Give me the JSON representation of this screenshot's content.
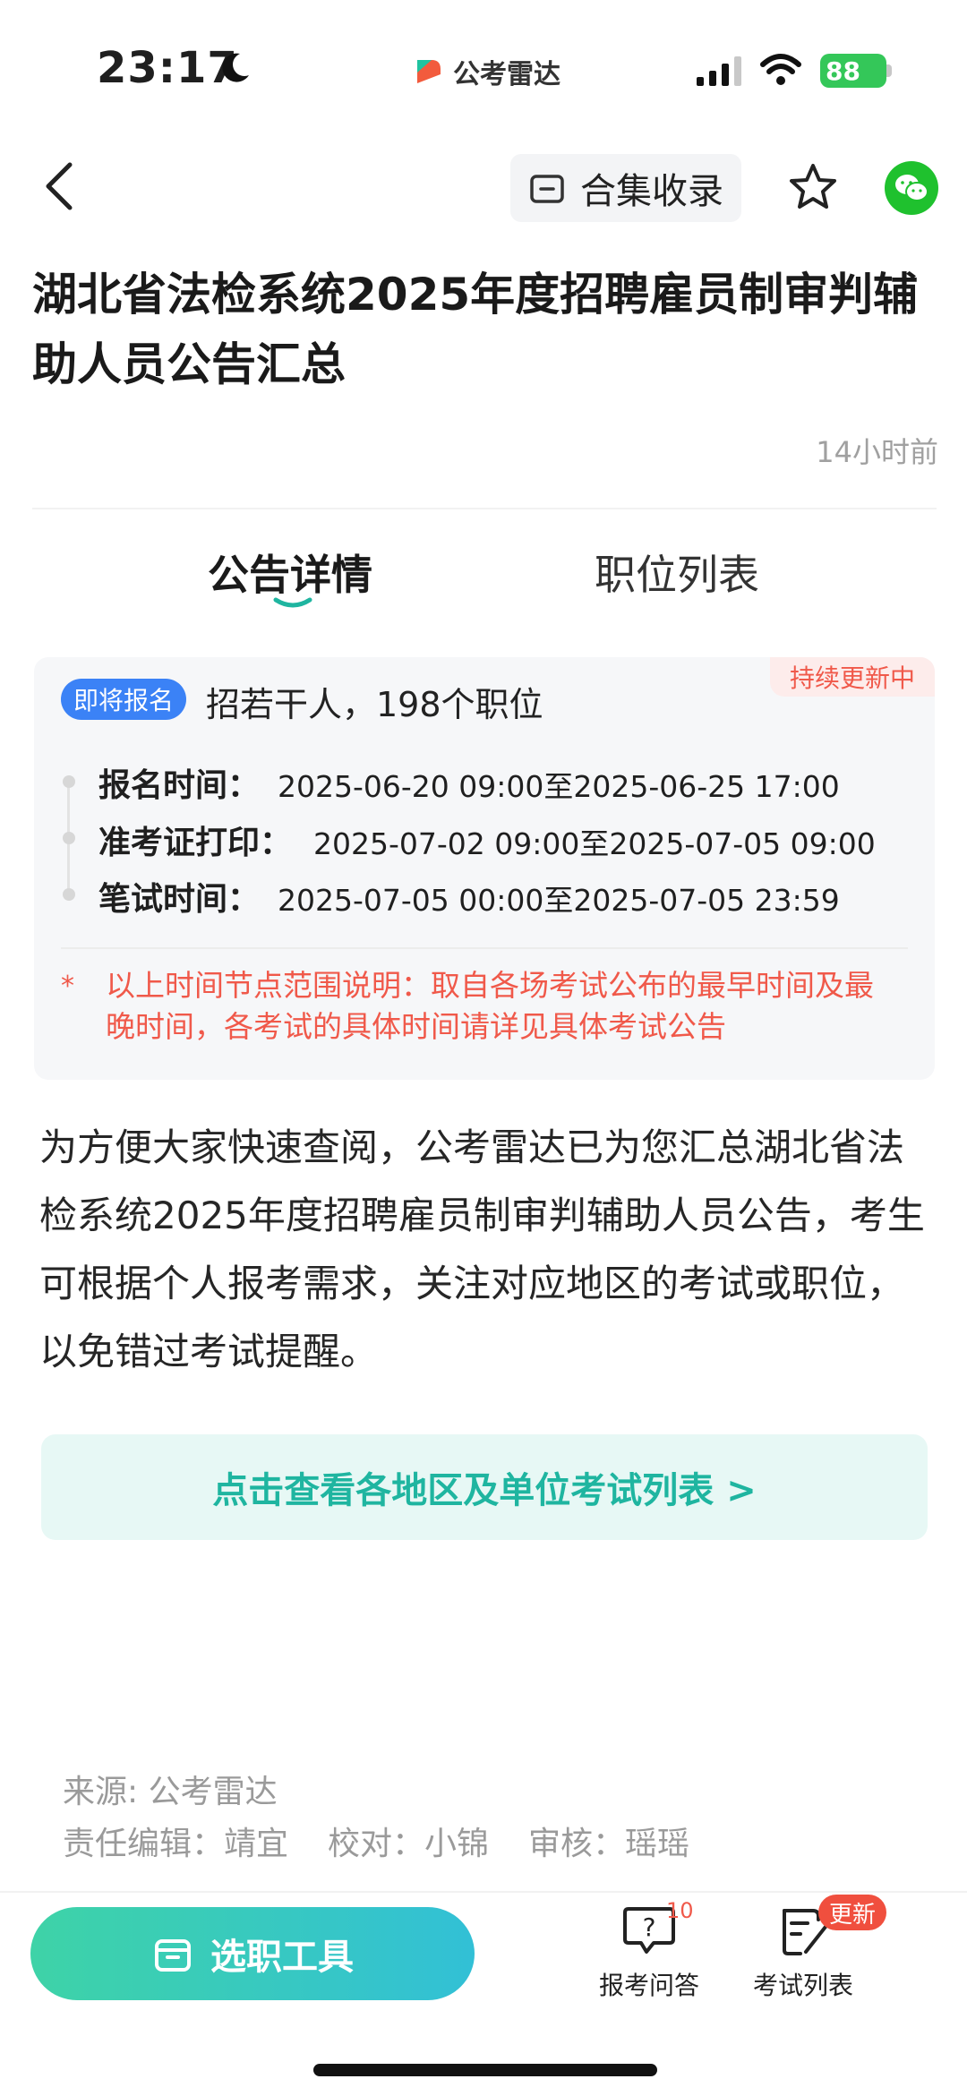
{
  "status_bar": {
    "time": "23:17",
    "app_name": "公考雷达",
    "battery": "88"
  },
  "nav": {
    "collect_label": "合集收录"
  },
  "article": {
    "title": "湖北省法检系统2025年度招聘雇员制审判辅助人员公告汇总",
    "time_ago": "14小时前"
  },
  "tabs": {
    "detail": "公告详情",
    "jobs": "职位列表"
  },
  "card": {
    "badge": "持续更新中",
    "status": "即将报名",
    "summary": "招若干人，198个职位",
    "timeline": [
      {
        "label": "报名时间：",
        "value": "2025-06-20 09:00至2025-06-25 17:00"
      },
      {
        "label": "准考证打印：",
        "value": "2025-07-02 09:00至2025-07-05 09:00"
      },
      {
        "label": "笔试时间：",
        "value": "2025-07-05 00:00至2025-07-05 23:59"
      }
    ],
    "note_mark": "*",
    "note": "以上时间节点范围说明：取自各场考试公布的最早时间及最晚时间，各考试的具体时间请详见具体考试公告"
  },
  "body": "为方便大家快速查阅，公考雷达已为您汇总湖北省法检系统2025年度招聘雇员制审判辅助人员公告，考生可根据个人报考需求，关注对应地区的考试或职位，以免错过考试提醒。",
  "cta_label": "点击查看各地区及单位考试列表 >",
  "footer": {
    "source": "来源: 公考雷达",
    "editor": "责任编辑：靖宜",
    "proof": "校对：小锦",
    "review": "审核：瑶瑶"
  },
  "bottom_bar": {
    "tool_label": "选职工具",
    "qa_label": "报考问答",
    "qa_count": "10",
    "exam_label": "考试列表",
    "exam_badge": "更新"
  },
  "colors": {
    "accent": "#1fb5a0",
    "status_blue": "#3b82f6",
    "warn_red": "#f0594a"
  }
}
